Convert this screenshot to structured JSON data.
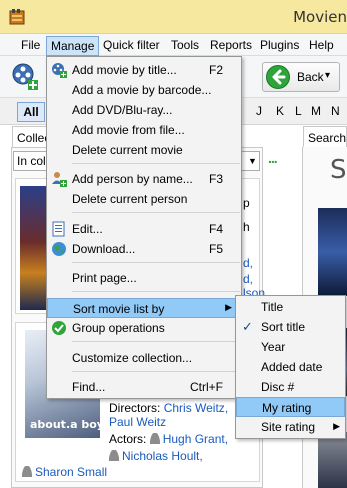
{
  "window": {
    "title": "Movien"
  },
  "menubar": {
    "file": "File",
    "manage": "Manage",
    "quick_filter": "Quick filter",
    "tools": "Tools",
    "reports": "Reports",
    "plugins": "Plugins",
    "help": "Help"
  },
  "toolbar": {
    "back_label": "Back",
    "back_caret": "▾"
  },
  "letters": {
    "all": "All",
    "list": [
      "J",
      "K",
      "L",
      "M",
      "N"
    ]
  },
  "left_panel": {
    "tab": "Collec",
    "filter_value": "In coll",
    "card1_partial": [
      "p",
      "h",
      "d,",
      "d,",
      "lson"
    ],
    "card2": {
      "poster_text": "about.a boy",
      "directors_label": "Directors:",
      "directors": [
        "Chris Weitz",
        "Paul Weitz"
      ],
      "actors_label": "Actors:",
      "actors": [
        "Hugh Grant,",
        "Nicholas Hoult,",
        "Sharon Small"
      ],
      "director_sep": ","
    }
  },
  "right_panel": {
    "tab": "Search",
    "letter": "S"
  },
  "manage_menu": {
    "items": [
      {
        "label": "Add movie by title...",
        "shortcut": "F2"
      },
      {
        "label": "Add a movie by barcode...",
        "shortcut": ""
      },
      {
        "label": "Add DVD/Blu-ray...",
        "shortcut": ""
      },
      {
        "label": "Add movie from file...",
        "shortcut": ""
      },
      {
        "label": "Delete current movie",
        "shortcut": ""
      },
      {
        "label": "Add person by name...",
        "shortcut": "F3"
      },
      {
        "label": "Delete current person",
        "shortcut": ""
      },
      {
        "label": "Edit...",
        "shortcut": "F4"
      },
      {
        "label": "Download...",
        "shortcut": "F5"
      },
      {
        "label": "Print page...",
        "shortcut": ""
      },
      {
        "label": "Sort movie list by",
        "shortcut": ""
      },
      {
        "label": "Group operations",
        "shortcut": ""
      },
      {
        "label": "Customize collection...",
        "shortcut": ""
      },
      {
        "label": "Find...",
        "shortcut": "Ctrl+F"
      }
    ],
    "submenu_arrow": "▶"
  },
  "sort_submenu": {
    "items": [
      {
        "label": "Title",
        "checked": false
      },
      {
        "label": "Sort title",
        "checked": true
      },
      {
        "label": "Year",
        "checked": false
      },
      {
        "label": "Added date",
        "checked": false
      },
      {
        "label": "Disc #",
        "checked": false
      },
      {
        "label": "My rating",
        "checked": false
      },
      {
        "label": "Site rating",
        "checked": false
      }
    ],
    "check_mark": "✓",
    "arrow": "▶"
  },
  "colors": {
    "title_bar": "#f7e8a0",
    "highlight": "#91c9f7",
    "link": "#1a5bbf",
    "back_green": "#2ea43a"
  }
}
